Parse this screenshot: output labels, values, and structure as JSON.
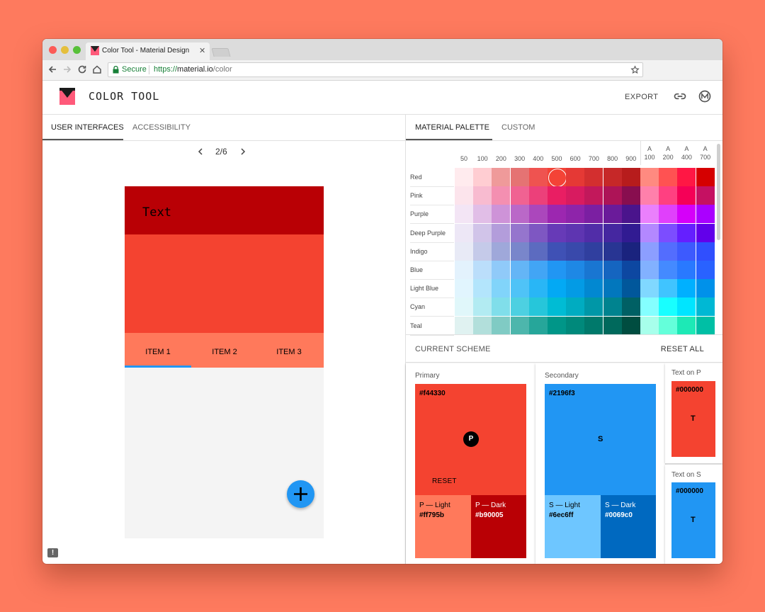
{
  "browser": {
    "tab_title": "Color Tool - Material Design",
    "close_glyph": "✕",
    "secure_label": "Secure",
    "url_scheme": "https://",
    "url_host": "material.io",
    "url_path": "/color"
  },
  "app": {
    "title": "COLOR TOOL",
    "export_label": "EXPORT"
  },
  "left": {
    "tabs": [
      "USER INTERFACES",
      "ACCESSIBILITY"
    ],
    "pager": "2/6",
    "phone": {
      "text": "Text",
      "items": [
        "ITEM 1",
        "ITEM 2",
        "ITEM 3"
      ]
    }
  },
  "right": {
    "tabs": [
      "MATERIAL PALETTE",
      "CUSTOM"
    ],
    "shade_headers": [
      "50",
      "100",
      "200",
      "300",
      "400",
      "500",
      "600",
      "700",
      "800",
      "900"
    ],
    "accent_prefix": "A",
    "accent_headers": [
      "100",
      "200",
      "400",
      "700"
    ],
    "selected": {
      "row": 0,
      "col": 5
    },
    "palette": [
      {
        "name": "Red",
        "colors": [
          "#ffebee",
          "#ffcdd2",
          "#ef9a9a",
          "#e57373",
          "#ef5350",
          "#f44336",
          "#e53935",
          "#d32f2f",
          "#c62828",
          "#b71c1c",
          "#ff8a80",
          "#ff5252",
          "#ff1744",
          "#d50000"
        ]
      },
      {
        "name": "Pink",
        "colors": [
          "#fce4ec",
          "#f8bbd0",
          "#f48fb1",
          "#f06292",
          "#ec407a",
          "#e91e63",
          "#d81b60",
          "#c2185b",
          "#ad1457",
          "#880e4f",
          "#ff80ab",
          "#ff4081",
          "#f50057",
          "#c51162"
        ]
      },
      {
        "name": "Purple",
        "colors": [
          "#f3e5f5",
          "#e1bee7",
          "#ce93d8",
          "#ba68c8",
          "#ab47bc",
          "#9c27b0",
          "#8e24aa",
          "#7b1fa2",
          "#6a1b9a",
          "#4a148c",
          "#ea80fc",
          "#e040fb",
          "#d500f9",
          "#aa00ff"
        ]
      },
      {
        "name": "Deep Purple",
        "colors": [
          "#ede7f6",
          "#d1c4e9",
          "#b39ddb",
          "#9575cd",
          "#7e57c2",
          "#673ab7",
          "#5e35b1",
          "#512da8",
          "#4527a0",
          "#311b92",
          "#b388ff",
          "#7c4dff",
          "#651fff",
          "#6200ea"
        ]
      },
      {
        "name": "Indigo",
        "colors": [
          "#e8eaf6",
          "#c5cae9",
          "#9fa8da",
          "#7986cb",
          "#5c6bc0",
          "#3f51b5",
          "#3949ab",
          "#303f9f",
          "#283593",
          "#1a237e",
          "#8c9eff",
          "#536dfe",
          "#3d5afe",
          "#304ffe"
        ]
      },
      {
        "name": "Blue",
        "colors": [
          "#e3f2fd",
          "#bbdefb",
          "#90caf9",
          "#64b5f6",
          "#42a5f5",
          "#2196f3",
          "#1e88e5",
          "#1976d2",
          "#1565c0",
          "#0d47a1",
          "#82b1ff",
          "#448aff",
          "#2979ff",
          "#2962ff"
        ]
      },
      {
        "name": "Light Blue",
        "colors": [
          "#e1f5fe",
          "#b3e5fc",
          "#81d4fa",
          "#4fc3f7",
          "#29b6f6",
          "#03a9f4",
          "#039be5",
          "#0288d1",
          "#0277bd",
          "#01579b",
          "#80d8ff",
          "#40c4ff",
          "#00b0ff",
          "#0091ea"
        ]
      },
      {
        "name": "Cyan",
        "colors": [
          "#e0f7fa",
          "#b2ebf2",
          "#80deea",
          "#4dd0e1",
          "#26c6da",
          "#00bcd4",
          "#00acc1",
          "#0097a7",
          "#00838f",
          "#006064",
          "#84ffff",
          "#18ffff",
          "#00e5ff",
          "#00b8d4"
        ]
      },
      {
        "name": "Teal",
        "colors": [
          "#e0f2f1",
          "#b2dfdb",
          "#80cbc4",
          "#4db6ac",
          "#26a69a",
          "#009688",
          "#00897b",
          "#00796b",
          "#00695c",
          "#004d40",
          "#a7ffeb",
          "#64ffda",
          "#1de9b6",
          "#00bfa5"
        ]
      }
    ],
    "scheme": {
      "title": "CURRENT SCHEME",
      "reset_all": "RESET ALL",
      "primary": {
        "label": "Primary",
        "hex": "#f44330",
        "letter": "P",
        "reset": "RESET",
        "light_label": "P — Light",
        "light_hex": "#ff795b",
        "dark_label": "P — Dark",
        "dark_hex": "#b90005"
      },
      "secondary": {
        "label": "Secondary",
        "hex": "#2196f3",
        "letter": "S",
        "light_label": "S — Light",
        "light_hex": "#6ec6ff",
        "dark_label": "S — Dark",
        "dark_hex": "#0069c0"
      },
      "text_on_p": {
        "label": "Text on P",
        "hex": "#000000",
        "letter": "T"
      },
      "text_on_s": {
        "label": "Text on S",
        "hex": "#000000",
        "letter": "T"
      }
    }
  },
  "colors": {
    "background": "#fe7a5e",
    "primary": "#f44330",
    "primary_light": "#ff795b",
    "primary_dark": "#b90005",
    "secondary": "#2196f3",
    "secondary_light": "#6ec6ff",
    "secondary_dark": "#0069c0"
  },
  "icons": [
    "back-icon",
    "forward-icon",
    "reload-icon",
    "home-icon",
    "lock-icon",
    "star-icon",
    "link-icon",
    "material-logo-icon",
    "chevron-left-icon",
    "chevron-right-icon",
    "plus-icon",
    "feedback-icon"
  ]
}
